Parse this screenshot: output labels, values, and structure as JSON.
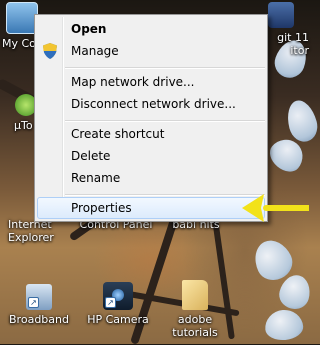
{
  "desktop": {
    "icons": [
      {
        "label": "My Co",
        "icon": "computer-icon"
      },
      {
        "label": "git 11\nitor",
        "icon": "editor-icon"
      },
      {
        "label": "µTo",
        "icon": "utorrent-icon"
      },
      {
        "label": "Internet\nExplorer",
        "icon": "internet-explorer-icon"
      },
      {
        "label": "Control Panel",
        "icon": "control-panel-icon"
      },
      {
        "label": "babi hits",
        "icon": "folder-icon"
      },
      {
        "label": "Broadband",
        "icon": "broadband-icon"
      },
      {
        "label": "HP Camera",
        "icon": "camera-icon"
      },
      {
        "label": "adobe\ntutorials",
        "icon": "folder-icon"
      }
    ]
  },
  "context_menu": {
    "items": [
      {
        "label": "Open",
        "bold": true
      },
      {
        "label": "Manage",
        "icon": "uac-shield-icon"
      },
      {
        "label": "Map network drive..."
      },
      {
        "label": "Disconnect network drive..."
      },
      {
        "label": "Create shortcut"
      },
      {
        "label": "Delete"
      },
      {
        "label": "Rename"
      },
      {
        "label": "Properties",
        "highlighted": true
      }
    ]
  },
  "annotation": {
    "type": "arrow",
    "color": "#f2e21a",
    "points_to": "Properties"
  },
  "colors": {
    "menu_bg": "#f0f0f0",
    "highlight": "#dcebfc",
    "arrow": "#f2e21a"
  }
}
